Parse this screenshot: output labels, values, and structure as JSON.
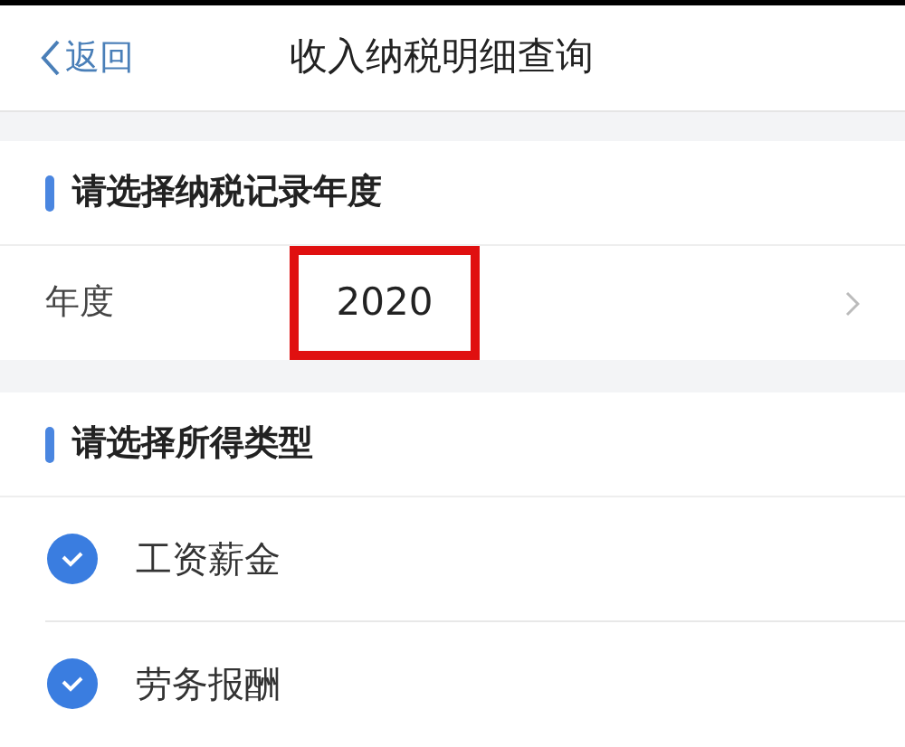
{
  "nav": {
    "back": "返回",
    "title": "收入纳税明细查询"
  },
  "year_section": {
    "heading": "请选择纳税记录年度",
    "label": "年度",
    "value": "2020",
    "highlighted": true
  },
  "type_section": {
    "heading": "请选择所得类型",
    "items": [
      {
        "label": "工资薪金",
        "checked": true
      },
      {
        "label": "劳务报酬",
        "checked": true
      }
    ]
  }
}
